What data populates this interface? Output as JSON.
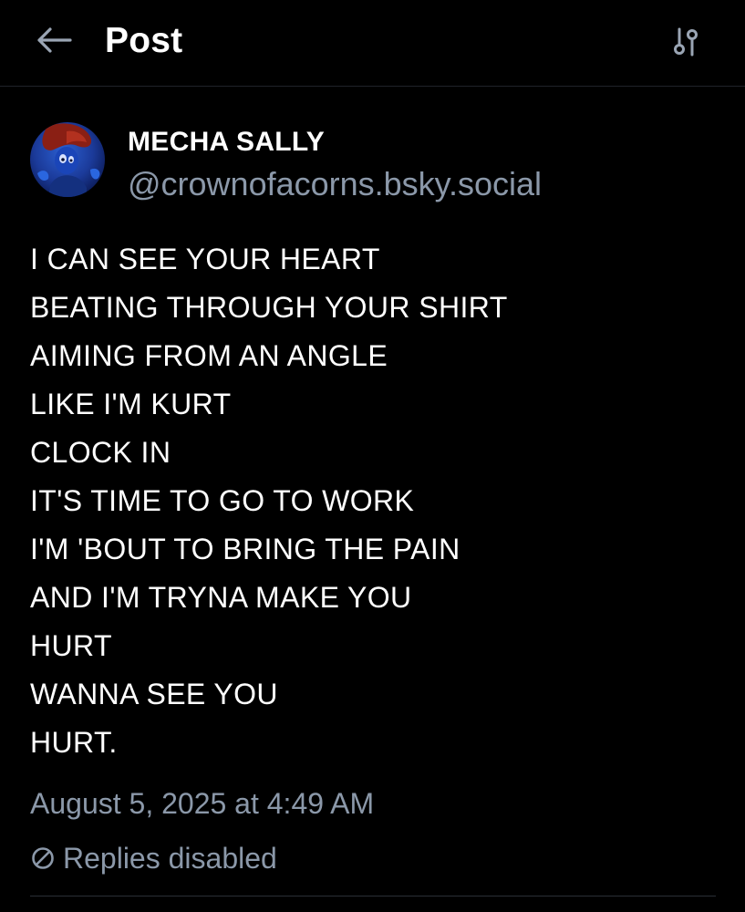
{
  "header": {
    "title": "Post",
    "back_icon": "arrow-left-icon",
    "settings_icon": "sliders-icon"
  },
  "author": {
    "display_name": "MECHA SALLY",
    "handle": "@crownofacorns.bsky.social"
  },
  "post": {
    "lines": [
      "I CAN SEE YOUR HEART",
      "BEATING THROUGH YOUR SHIRT",
      "AIMING FROM AN ANGLE",
      "LIKE I'M KURT",
      "CLOCK IN",
      "IT'S TIME TO GO TO WORK",
      "I'M 'BOUT TO BRING THE PAIN",
      "AND I'M TRYNA MAKE YOU",
      "HURT",
      "WANNA SEE YOU",
      "HURT."
    ],
    "timestamp": "August 5, 2025 at 4:49 AM",
    "replies_status": "Replies disabled"
  },
  "colors": {
    "background": "#000000",
    "text_primary": "#ffffff",
    "text_secondary": "#8b98a9"
  }
}
